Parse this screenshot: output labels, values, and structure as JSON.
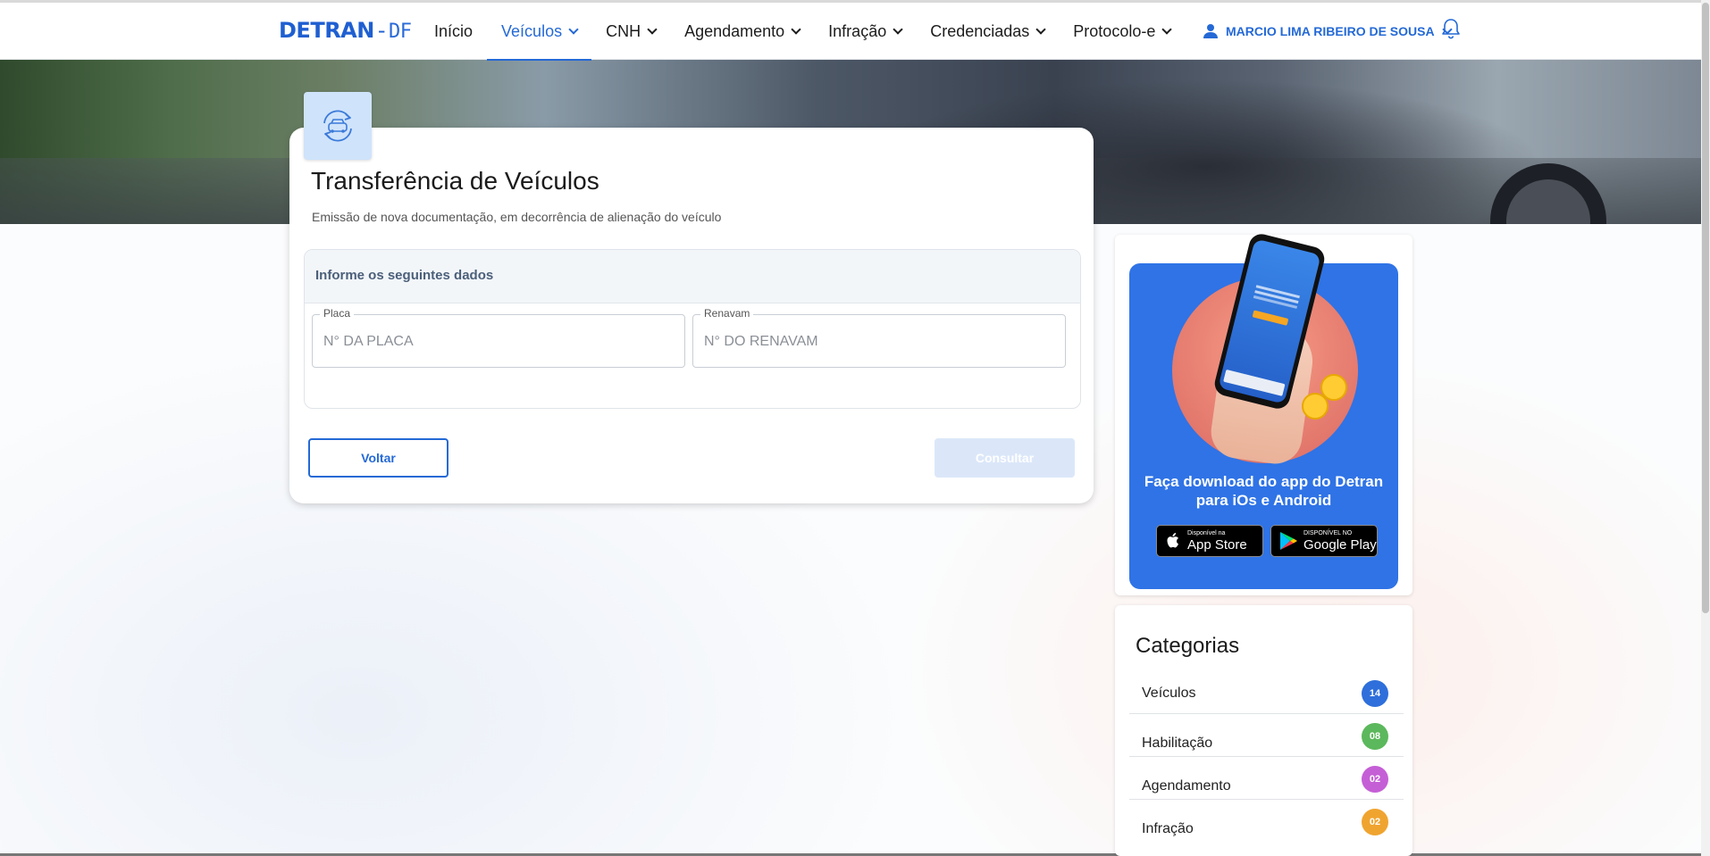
{
  "header": {
    "logo_main": "DETRAN",
    "logo_sep": "-",
    "logo_suffix": "DF",
    "nav": [
      {
        "label": "Início",
        "has_dropdown": false,
        "active": false
      },
      {
        "label": "Veículos",
        "has_dropdown": true,
        "active": true
      },
      {
        "label": "CNH",
        "has_dropdown": true,
        "active": false
      },
      {
        "label": "Agendamento",
        "has_dropdown": true,
        "active": false
      },
      {
        "label": "Infração",
        "has_dropdown": true,
        "active": false
      },
      {
        "label": "Credenciadas",
        "has_dropdown": true,
        "active": false
      },
      {
        "label": "Protocolo-e",
        "has_dropdown": true,
        "active": false
      }
    ],
    "user_name": "MARCIO LIMA RIBEIRO DE SOUSA",
    "user_icon": "person-icon",
    "bell_icon": "bell-icon"
  },
  "service": {
    "icon": "car-transfer-icon",
    "title": "Transferência de Veículos",
    "subtitle": "Emissão de nova documentação, em decorrência de alienação do veículo"
  },
  "form": {
    "heading": "Informe os seguintes dados",
    "placa": {
      "label": "Placa",
      "placeholder": "N° DA PLACA",
      "value": ""
    },
    "renavam": {
      "label": "Renavam",
      "placeholder": "N° DO RENAVAM",
      "value": ""
    },
    "back_label": "Voltar",
    "submit_label": "Consultar",
    "submit_disabled": true
  },
  "app_promo": {
    "text": "Faça download do app do Detran para iOs e Android",
    "appstore_small": "Disponível na",
    "appstore_big": "App Store",
    "googleplay_small": "DISPONÍVEL NO",
    "googleplay_big": "Google Play"
  },
  "categories": {
    "title": "Categorias",
    "items": [
      {
        "name": "Veículos",
        "count": "14",
        "color": "#2e6fdb"
      },
      {
        "name": "Habilitação",
        "count": "08",
        "color": "#5cb85c"
      },
      {
        "name": "Agendamento",
        "count": "02",
        "color": "#c55fd6"
      },
      {
        "name": "Infração",
        "count": "02",
        "color": "#f0a430"
      }
    ]
  },
  "colors": {
    "accent": "#2469d6",
    "promo_bg": "#2f73e6",
    "disabled_button": "#dbe7f9"
  }
}
